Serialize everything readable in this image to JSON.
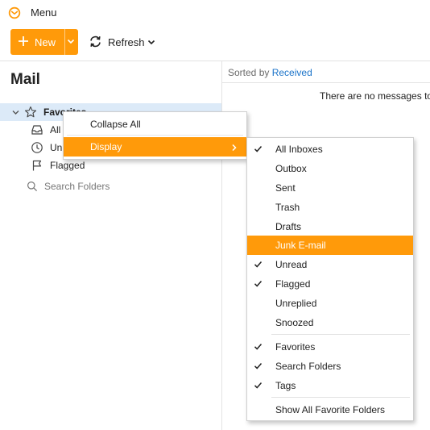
{
  "header": {
    "menu_label": "Menu"
  },
  "toolbar": {
    "new_label": "New",
    "refresh_label": "Refresh"
  },
  "sidebar": {
    "title": "Mail",
    "favorites_label": "Favorites",
    "items": [
      {
        "label": "All Inboxes",
        "icon": "inbox-icon"
      },
      {
        "label": "Unread",
        "icon": "clock-icon"
      },
      {
        "label": "Flagged",
        "icon": "flag-icon"
      }
    ],
    "search_folders_label": "Search Folders"
  },
  "list": {
    "sorted_by_label": "Sorted by",
    "sorted_by_value": "Received",
    "empty_message": "There are no messages to s"
  },
  "context_menu": {
    "collapse_all": "Collapse All",
    "display": "Display"
  },
  "submenu": {
    "items": [
      {
        "label": "All Inboxes",
        "checked": true
      },
      {
        "label": "Outbox",
        "checked": false
      },
      {
        "label": "Sent",
        "checked": false
      },
      {
        "label": "Trash",
        "checked": false
      },
      {
        "label": "Drafts",
        "checked": false
      },
      {
        "label": "Junk E-mail",
        "checked": false,
        "highlighted": true
      },
      {
        "label": "Unread",
        "checked": true
      },
      {
        "label": "Flagged",
        "checked": true
      },
      {
        "label": "Unreplied",
        "checked": false
      },
      {
        "label": "Snoozed",
        "checked": false
      },
      {
        "label": "Favorites",
        "checked": true
      },
      {
        "label": "Search Folders",
        "checked": true
      },
      {
        "label": "Tags",
        "checked": true
      },
      {
        "label": "Show All Favorite Folders",
        "checked": false
      }
    ]
  },
  "colors": {
    "accent": "#ff9a0a",
    "selection": "#dceaf8",
    "link": "#1a73c9"
  }
}
